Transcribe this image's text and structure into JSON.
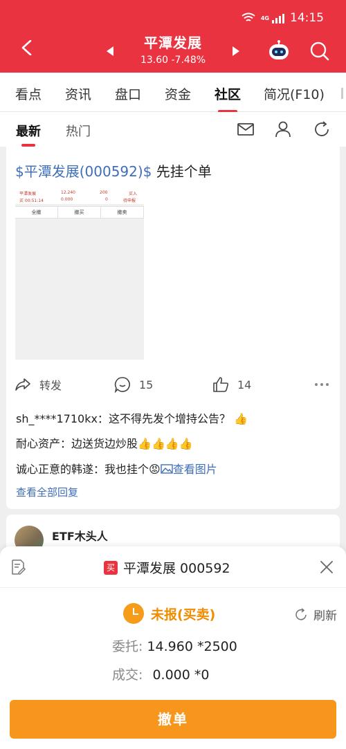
{
  "status_bar": {
    "network": "4G",
    "time": "14:15"
  },
  "header": {
    "title": "平潭发展",
    "price": "13.60",
    "change": "-7.48%"
  },
  "tabs": [
    "看点",
    "资讯",
    "盘口",
    "资金",
    "社区",
    "简况(F10)"
  ],
  "active_tab": "社区",
  "subtabs": [
    "最新",
    "热门"
  ],
  "post": {
    "title_link": "$平潭发展(000592)$",
    "title_text": " 先挂个单",
    "thumbnail": {
      "name": "平潭发展",
      "code_time": "买 00:51:14",
      "price": "12.240",
      "deal": "0.000",
      "qty": "200",
      "qty2": "0",
      "side": "买入",
      "state": "待申报",
      "buttons": [
        "全撤",
        "撤买",
        "撤卖"
      ]
    },
    "actions": {
      "forward": "转发",
      "comments": "15",
      "likes": "14"
    },
    "comments": [
      {
        "user": "sh_****1710kx：",
        "text": "这不得先发个增持公告？",
        "emoji": "👍"
      },
      {
        "user": "耐心资产：",
        "text": "边送货边炒股",
        "emoji": "👍👍👍👍"
      },
      {
        "user": "诚心正意的韩遂：",
        "text": "我也挂个",
        "emoji": "😡",
        "link": "查看图片"
      }
    ],
    "view_all": "查看全部回复"
  },
  "next_post": {
    "author": "ETF木头人"
  },
  "order_sheet": {
    "badge": "买",
    "title": "平潭发展 000592",
    "status": "未报(买卖)",
    "refresh": "刷新",
    "entrust_label": "委托:",
    "entrust_value": "14.960 *2500",
    "deal_label": "成交:",
    "deal_value": "0.000 *0",
    "cancel_button": "撤单"
  },
  "colors": {
    "brand_red": "#ea3340",
    "accent_orange": "#f7961c",
    "link_blue": "#3f6eb8"
  }
}
